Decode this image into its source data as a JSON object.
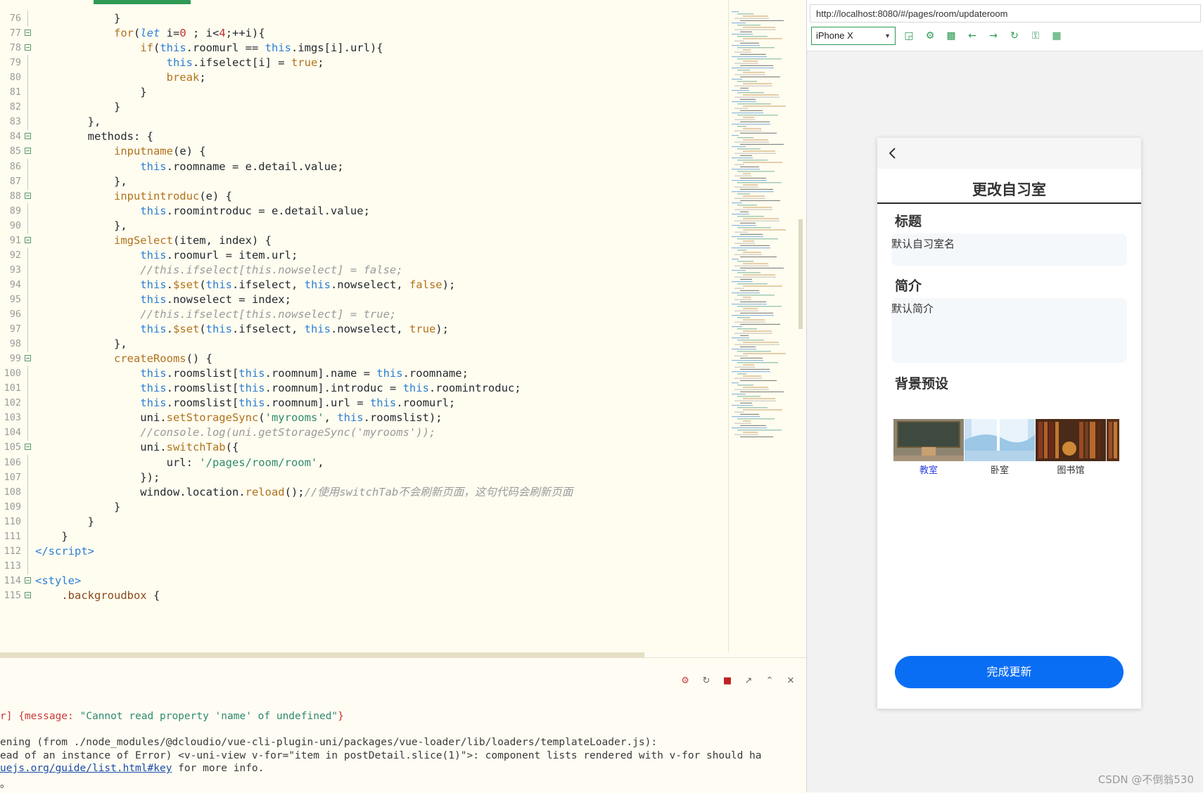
{
  "editor": {
    "lines": [
      {
        "n": "76",
        "fold": false,
        "html": "            <span class='tk-pun'>}</span>"
      },
      {
        "n": "77",
        "fold": true,
        "html": "            <span class='tk-fn'>for</span>(<span class='tk-let'>let</span> i=<span class='tk-num'>0</span> ; i&lt;<span class='tk-num'>4</span>;++i){"
      },
      {
        "n": "78",
        "fold": true,
        "html": "                <span class='tk-fn'>if</span>(<span class='tk-kw'>this</span>.roomurl == <span class='tk-kw'>this</span>.imgs[i].url){"
      },
      {
        "n": "79",
        "fold": false,
        "html": "                    <span class='tk-kw'>this</span>.ifselect[i] = <span class='tk-bool'>true</span>;"
      },
      {
        "n": "80",
        "fold": false,
        "html": "                    <span class='tk-bool'>break</span>;"
      },
      {
        "n": "81",
        "fold": false,
        "html": "                }"
      },
      {
        "n": "82",
        "fold": false,
        "html": "            }"
      },
      {
        "n": "83",
        "fold": false,
        "html": "        },"
      },
      {
        "n": "84",
        "fold": true,
        "html": "        methods: {"
      },
      {
        "n": "85",
        "fold": true,
        "html": "            <span class='tk-fn'>inputname</span>(e) {"
      },
      {
        "n": "86",
        "fold": false,
        "html": "                <span class='tk-kw'>this</span>.roomname = e.detail.value;"
      },
      {
        "n": "87",
        "fold": false,
        "html": "            },"
      },
      {
        "n": "88",
        "fold": true,
        "html": "            <span class='tk-fn'>inputintroduc</span>(e) {"
      },
      {
        "n": "89",
        "fold": false,
        "html": "                <span class='tk-kw'>this</span>.roomintroduc = e.detail.value;"
      },
      {
        "n": "90",
        "fold": false,
        "html": "            },"
      },
      {
        "n": "91",
        "fold": true,
        "html": "            <span class='tk-fn'>imgSelect</span>(item, index) {"
      },
      {
        "n": "92",
        "fold": false,
        "html": "                <span class='tk-kw'>this</span>.roomurl = item.url;"
      },
      {
        "n": "93",
        "fold": false,
        "html": "                <span class='tk-com'>//this.ifselect[this.nowselect] = false;</span>"
      },
      {
        "n": "94",
        "fold": false,
        "html": "                <span class='tk-kw'>this</span>.<span class='tk-fn'>$set</span>(<span class='tk-kw'>this</span>.ifselect, <span class='tk-kw'>this</span>.nowselect, <span class='tk-bool'>false</span>);"
      },
      {
        "n": "95",
        "fold": false,
        "html": "                <span class='tk-kw'>this</span>.nowselect = index;"
      },
      {
        "n": "96",
        "fold": false,
        "html": "                <span class='tk-com'>//this.ifselect[this.nowselect] = true;</span>"
      },
      {
        "n": "97",
        "fold": false,
        "html": "                <span class='tk-kw'>this</span>.<span class='tk-fn'>$set</span>(<span class='tk-kw'>this</span>.ifselect, <span class='tk-kw'>this</span>.nowselect, <span class='tk-bool'>true</span>);"
      },
      {
        "n": "98",
        "fold": false,
        "html": "            },"
      },
      {
        "n": "99",
        "fold": true,
        "html": "            <span class='tk-fn'>createRooms</span>() {"
      },
      {
        "n": "100",
        "fold": false,
        "html": "                <span class='tk-kw'>this</span>.roomslist[<span class='tk-kw'>this</span>.roomnum].name = <span class='tk-kw'>this</span>.roomname;"
      },
      {
        "n": "101",
        "fold": false,
        "html": "                <span class='tk-kw'>this</span>.roomslist[<span class='tk-kw'>this</span>.roomnum].introduc = <span class='tk-kw'>this</span>.roomintroduc;"
      },
      {
        "n": "102",
        "fold": false,
        "html": "                <span class='tk-kw'>this</span>.roomslist[<span class='tk-kw'>this</span>.roomnum].url = <span class='tk-kw'>this</span>.roomurl;"
      },
      {
        "n": "103",
        "fold": false,
        "html": "                uni.<span class='tk-fn'>setStorageSync</span>(<span class='tk-str'>'myrooms'</span>, <span class='tk-kw'>this</span>.roomslist);"
      },
      {
        "n": "104",
        "fold": false,
        "html": "                <span class='tk-com'>//console.log(uni.getStorageSync('myrooms'));</span>"
      },
      {
        "n": "105",
        "fold": true,
        "html": "                uni.<span class='tk-fn'>switchTab</span>({"
      },
      {
        "n": "106",
        "fold": false,
        "html": "                    url: <span class='tk-str'>'/pages/room/room'</span>,"
      },
      {
        "n": "107",
        "fold": false,
        "html": "                });"
      },
      {
        "n": "108",
        "fold": false,
        "html": "                window.location.<span class='tk-fn'>reload</span>();<span class='tk-com'>//使用switchTab不会刷新页面，这句代码会刷新页面</span>"
      },
      {
        "n": "109",
        "fold": false,
        "html": "            }"
      },
      {
        "n": "110",
        "fold": false,
        "html": "        }"
      },
      {
        "n": "111",
        "fold": false,
        "html": "    }"
      },
      {
        "n": "112",
        "fold": false,
        "html": "<span class='tk-tag'>&lt;/script&gt;</span>"
      },
      {
        "n": "113",
        "fold": false,
        "html": ""
      },
      {
        "n": "114",
        "fold": true,
        "html": "<span class='tk-tag'>&lt;style&gt;</span>"
      },
      {
        "n": "115",
        "fold": true,
        "html": "    <span class='tk-sel'>.backgroudbox</span> {"
      }
    ]
  },
  "console": {
    "lines": [
      {
        "html": "<span class='c-red'>r] {message: </span><span class='tk-str'>\"Cannot read property 'name' of undefined\"</span><span class='c-red'>}</span>"
      },
      {
        "html": "ening (from ./node_modules/@dcloudio/vue-cli-plugin-uni/packages/vue-loader/lib/loaders/templateLoader.js):"
      },
      {
        "html": "ead of an instance of Error) &lt;v-uni-view v-for=\"item in postDetail.slice(1)\"&gt;: component lists rendered with v-for should ha"
      },
      {
        "html": "<span class='c-link'>uejs.org/guide/list.html#key</span> for more info."
      },
      {
        "html": "。"
      }
    ]
  },
  "browser": {
    "url": "http://localhost:8080/#/pages/room/updateroom",
    "device": "iPhone X"
  },
  "phone": {
    "heading": "更改自习室",
    "title_label": "标题",
    "title_value": "默认自习室名",
    "intro_label": "简介",
    "intro_value": "默认简介",
    "bg_label": "背景预设",
    "thumbs": [
      {
        "label": "教室",
        "active": true
      },
      {
        "label": "卧室",
        "active": false
      },
      {
        "label": "图书馆",
        "active": false
      }
    ],
    "submit": "完成更新"
  },
  "watermark": "CSDN @不倒翁530",
  "colors": {
    "accent": "#0a6ef5",
    "editor_bg": "#fffcf0",
    "tool_green": "#2d9a55"
  }
}
